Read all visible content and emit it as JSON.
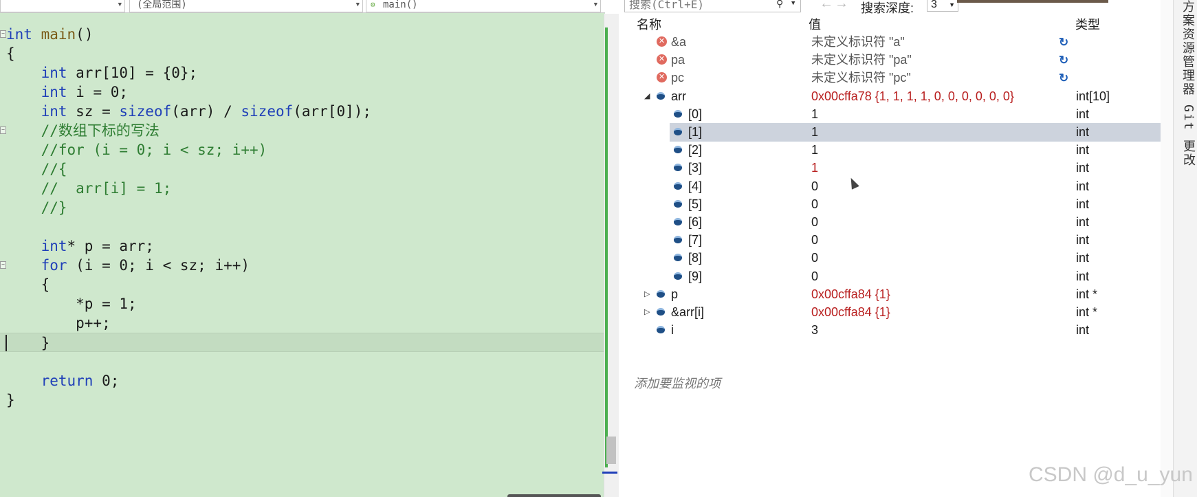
{
  "editor": {
    "nav": {
      "scope": "",
      "file_scope": "(全局范围)",
      "function": "main()"
    },
    "code_lines": [
      {
        "segments": [
          {
            "t": "int",
            "c": "kw"
          },
          {
            "t": " "
          },
          {
            "t": "main",
            "c": "fn"
          },
          {
            "t": "()"
          }
        ],
        "fold": true
      },
      {
        "segments": [
          {
            "t": "{"
          }
        ]
      },
      {
        "segments": [
          {
            "t": "    "
          },
          {
            "t": "int",
            "c": "kw"
          },
          {
            "t": " arr[10] = {0};"
          }
        ]
      },
      {
        "segments": [
          {
            "t": "    "
          },
          {
            "t": "int",
            "c": "kw"
          },
          {
            "t": " i = 0;"
          }
        ]
      },
      {
        "segments": [
          {
            "t": "    "
          },
          {
            "t": "int",
            "c": "kw"
          },
          {
            "t": " sz = "
          },
          {
            "t": "sizeof",
            "c": "kw"
          },
          {
            "t": "(arr) / "
          },
          {
            "t": "sizeof",
            "c": "kw"
          },
          {
            "t": "(arr[0]);"
          }
        ]
      },
      {
        "segments": [
          {
            "t": "    "
          },
          {
            "t": "//数组下标的写法",
            "c": "cm"
          }
        ],
        "fold": true
      },
      {
        "segments": [
          {
            "t": "    "
          },
          {
            "t": "//for (i = 0; i < sz; i++)",
            "c": "cm"
          }
        ]
      },
      {
        "segments": [
          {
            "t": "    "
          },
          {
            "t": "//{",
            "c": "cm"
          }
        ]
      },
      {
        "segments": [
          {
            "t": "    "
          },
          {
            "t": "//  arr[i] = 1;",
            "c": "cm"
          }
        ]
      },
      {
        "segments": [
          {
            "t": "    "
          },
          {
            "t": "//}",
            "c": "cm"
          }
        ]
      },
      {
        "segments": [
          {
            "t": ""
          }
        ]
      },
      {
        "segments": [
          {
            "t": "    "
          },
          {
            "t": "int",
            "c": "kw"
          },
          {
            "t": "* p = arr;"
          }
        ]
      },
      {
        "segments": [
          {
            "t": "    "
          },
          {
            "t": "for",
            "c": "kw"
          },
          {
            "t": " (i = 0; i < sz; i++)"
          }
        ],
        "fold": true
      },
      {
        "segments": [
          {
            "t": "    {"
          }
        ]
      },
      {
        "segments": [
          {
            "t": "        *p = 1;"
          }
        ]
      },
      {
        "segments": [
          {
            "t": "        p++;"
          }
        ]
      },
      {
        "segments": [
          {
            "t": "    }"
          }
        ],
        "current": true
      },
      {
        "segments": [
          {
            "t": ""
          }
        ]
      },
      {
        "segments": [
          {
            "t": "    "
          },
          {
            "t": "return",
            "c": "kw"
          },
          {
            "t": " 0;"
          }
        ]
      },
      {
        "segments": [
          {
            "t": "}"
          }
        ]
      }
    ]
  },
  "watch": {
    "search_placeholder": "搜索(Ctrl+E)",
    "search_icon": "search-icon",
    "depth_label": "搜索深度:",
    "depth_value": "3",
    "headers": {
      "name": "名称",
      "value": "值",
      "type": "类型"
    },
    "rows": [
      {
        "name": "&a",
        "value": "未定义标识符 \"a\"",
        "type": "",
        "icon": "error",
        "level": 0,
        "refresh": true
      },
      {
        "name": "pa",
        "value": "未定义标识符 \"pa\"",
        "type": "",
        "icon": "error",
        "level": 0,
        "refresh": true
      },
      {
        "name": "pc",
        "value": "未定义标识符 \"pc\"",
        "type": "",
        "icon": "error",
        "level": 0,
        "refresh": true
      },
      {
        "name": "arr",
        "value": "0x00cffa78 {1, 1, 1, 1, 0, 0, 0, 0, 0, 0}",
        "type": "int[10]",
        "icon": "variable",
        "level": 0,
        "expander": "expanded",
        "changed": true
      },
      {
        "name": "[0]",
        "value": "1",
        "type": "int",
        "icon": "variable",
        "level": 1
      },
      {
        "name": "[1]",
        "value": "1",
        "type": "int",
        "icon": "variable",
        "level": 1,
        "selected": true
      },
      {
        "name": "[2]",
        "value": "1",
        "type": "int",
        "icon": "variable",
        "level": 1
      },
      {
        "name": "[3]",
        "value": "1",
        "type": "int",
        "icon": "variable",
        "level": 1,
        "changed": true
      },
      {
        "name": "[4]",
        "value": "0",
        "type": "int",
        "icon": "variable",
        "level": 1
      },
      {
        "name": "[5]",
        "value": "0",
        "type": "int",
        "icon": "variable",
        "level": 1
      },
      {
        "name": "[6]",
        "value": "0",
        "type": "int",
        "icon": "variable",
        "level": 1
      },
      {
        "name": "[7]",
        "value": "0",
        "type": "int",
        "icon": "variable",
        "level": 1
      },
      {
        "name": "[8]",
        "value": "0",
        "type": "int",
        "icon": "variable",
        "level": 1
      },
      {
        "name": "[9]",
        "value": "0",
        "type": "int",
        "icon": "variable",
        "level": 1
      },
      {
        "name": "p",
        "value": "0x00cffa84 {1}",
        "type": "int *",
        "icon": "variable",
        "level": 0,
        "expander": "collapsed",
        "changed": true
      },
      {
        "name": "&arr[i]",
        "value": "0x00cffa84 {1}",
        "type": "int *",
        "icon": "variable",
        "level": 0,
        "expander": "collapsed",
        "changed": true
      },
      {
        "name": "i",
        "value": "3",
        "type": "int",
        "icon": "variable",
        "level": 0
      }
    ],
    "add_watch_label": "添加要监视的项"
  },
  "side_tabs": {
    "solution_explorer": "方案资源管理器",
    "git_changes": "Git 更改"
  },
  "watermark": "CSDN @d_u_yun",
  "colors": {
    "editor_bg": "#cfe8cd",
    "keyword": "#1f3fb8",
    "comment": "#2e7d32",
    "changed_value": "#b81e1e",
    "selected_row": "#cdd3dd"
  }
}
